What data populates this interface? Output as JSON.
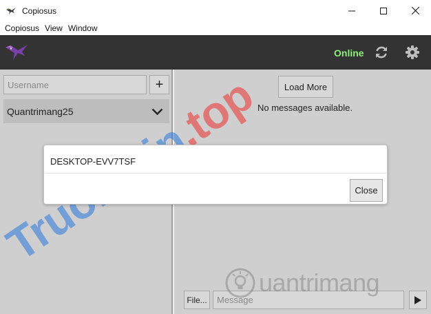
{
  "window": {
    "title": "Copiosus",
    "controls": [
      "minimize-icon",
      "maximize-icon",
      "close-icon"
    ]
  },
  "menu": {
    "items": [
      "Copiosus",
      "View",
      "Window"
    ]
  },
  "header": {
    "status": "Online",
    "status_color": "#8cf07a",
    "background": "#333333",
    "icons": [
      "bird-logo-icon",
      "refresh-icon",
      "gear-icon"
    ]
  },
  "sidebar": {
    "username_placeholder": "Username",
    "add_label": "+",
    "friends": [
      {
        "name": "Quantrimang25"
      }
    ]
  },
  "main": {
    "load_more_label": "Load More",
    "no_messages": "No messages available.",
    "file_label": "File...",
    "message_placeholder": "Message"
  },
  "dialog": {
    "title": "DESKTOP-EVV7TSF",
    "close_label": "Close"
  },
  "watermarks": {
    "left": {
      "main": "Truongtin",
      "accent": ".top"
    },
    "right": "uantrimang"
  }
}
